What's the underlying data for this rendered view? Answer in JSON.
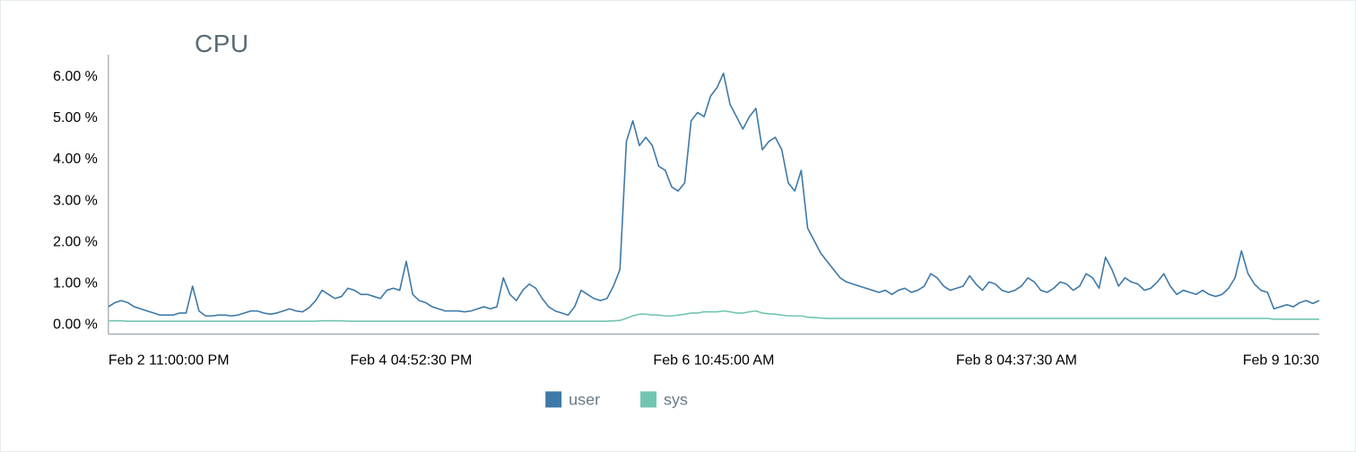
{
  "colors": {
    "user": "#3e79a8",
    "sys": "#73c5b3",
    "axis": "#9aa4ad",
    "border": "#e6ebef",
    "text": "#6a7a85"
  },
  "chart_data": {
    "type": "line",
    "title": "CPU",
    "ylabel": "",
    "xlabel": "",
    "ylim": [
      0,
      6.5
    ],
    "y_ticks": [
      "0.00 %",
      "1.00 %",
      "2.00 %",
      "3.00 %",
      "4.00 %",
      "5.00 %",
      "6.00 %"
    ],
    "x_tick_labels": [
      "Feb 2 11:00:00 PM",
      "Feb 4 04:52:30 PM",
      "Feb 6 10:45:00 AM",
      "Feb 8 04:37:30 AM",
      "Feb 9 10:30"
    ],
    "x_tick_frac": [
      0.0,
      0.25,
      0.5,
      0.75,
      1.0
    ],
    "legend": [
      "user",
      "sys"
    ],
    "series": [
      {
        "name": "user",
        "values": [
          0.4,
          0.5,
          0.55,
          0.5,
          0.4,
          0.35,
          0.3,
          0.25,
          0.2,
          0.2,
          0.2,
          0.25,
          0.25,
          0.9,
          0.3,
          0.18,
          0.18,
          0.2,
          0.2,
          0.18,
          0.2,
          0.25,
          0.3,
          0.3,
          0.25,
          0.22,
          0.25,
          0.3,
          0.35,
          0.3,
          0.28,
          0.38,
          0.55,
          0.8,
          0.7,
          0.6,
          0.65,
          0.85,
          0.8,
          0.7,
          0.7,
          0.65,
          0.6,
          0.8,
          0.85,
          0.8,
          1.5,
          0.7,
          0.55,
          0.5,
          0.4,
          0.35,
          0.3,
          0.3,
          0.3,
          0.28,
          0.3,
          0.35,
          0.4,
          0.35,
          0.4,
          1.1,
          0.7,
          0.55,
          0.8,
          0.95,
          0.85,
          0.6,
          0.4,
          0.3,
          0.25,
          0.2,
          0.4,
          0.8,
          0.7,
          0.6,
          0.55,
          0.6,
          0.9,
          1.3,
          4.4,
          4.9,
          4.3,
          4.5,
          4.3,
          3.8,
          3.7,
          3.3,
          3.2,
          3.4,
          4.9,
          5.1,
          5.0,
          5.5,
          5.7,
          6.05,
          5.3,
          5.0,
          4.7,
          5.0,
          5.2,
          4.2,
          4.4,
          4.5,
          4.2,
          3.4,
          3.2,
          3.7,
          2.3,
          2.0,
          1.7,
          1.5,
          1.3,
          1.1,
          1.0,
          0.95,
          0.9,
          0.85,
          0.8,
          0.75,
          0.8,
          0.7,
          0.8,
          0.85,
          0.75,
          0.8,
          0.9,
          1.2,
          1.1,
          0.9,
          0.8,
          0.85,
          0.9,
          1.15,
          0.95,
          0.8,
          1.0,
          0.95,
          0.8,
          0.75,
          0.8,
          0.9,
          1.1,
          1.0,
          0.8,
          0.75,
          0.85,
          1.0,
          0.95,
          0.8,
          0.9,
          1.2,
          1.1,
          0.85,
          1.6,
          1.3,
          0.9,
          1.1,
          1.0,
          0.95,
          0.8,
          0.85,
          1.0,
          1.2,
          0.9,
          0.7,
          0.8,
          0.75,
          0.7,
          0.8,
          0.7,
          0.65,
          0.7,
          0.85,
          1.1,
          1.75,
          1.2,
          0.95,
          0.8,
          0.75,
          0.35,
          0.4,
          0.45,
          0.4,
          0.5,
          0.55,
          0.48,
          0.55
        ]
      },
      {
        "name": "sys",
        "values": [
          0.06,
          0.06,
          0.06,
          0.05,
          0.05,
          0.05,
          0.05,
          0.05,
          0.05,
          0.05,
          0.05,
          0.05,
          0.05,
          0.05,
          0.05,
          0.05,
          0.05,
          0.05,
          0.05,
          0.05,
          0.05,
          0.05,
          0.05,
          0.05,
          0.05,
          0.05,
          0.05,
          0.05,
          0.05,
          0.05,
          0.05,
          0.05,
          0.05,
          0.06,
          0.06,
          0.06,
          0.06,
          0.05,
          0.05,
          0.05,
          0.05,
          0.05,
          0.05,
          0.05,
          0.05,
          0.05,
          0.05,
          0.05,
          0.05,
          0.05,
          0.05,
          0.05,
          0.05,
          0.05,
          0.05,
          0.05,
          0.05,
          0.05,
          0.05,
          0.05,
          0.05,
          0.05,
          0.05,
          0.05,
          0.05,
          0.05,
          0.05,
          0.05,
          0.05,
          0.05,
          0.05,
          0.05,
          0.05,
          0.05,
          0.05,
          0.05,
          0.05,
          0.05,
          0.06,
          0.07,
          0.12,
          0.18,
          0.22,
          0.22,
          0.2,
          0.2,
          0.18,
          0.18,
          0.2,
          0.22,
          0.25,
          0.25,
          0.28,
          0.28,
          0.28,
          0.3,
          0.28,
          0.25,
          0.25,
          0.28,
          0.3,
          0.25,
          0.23,
          0.22,
          0.2,
          0.18,
          0.18,
          0.18,
          0.15,
          0.14,
          0.13,
          0.12,
          0.12,
          0.12,
          0.12,
          0.12,
          0.12,
          0.12,
          0.12,
          0.12,
          0.12,
          0.12,
          0.12,
          0.12,
          0.12,
          0.12,
          0.12,
          0.12,
          0.12,
          0.12,
          0.12,
          0.12,
          0.12,
          0.12,
          0.12,
          0.12,
          0.12,
          0.12,
          0.12,
          0.12,
          0.12,
          0.12,
          0.12,
          0.12,
          0.12,
          0.12,
          0.12,
          0.12,
          0.12,
          0.12,
          0.12,
          0.12,
          0.12,
          0.12,
          0.12,
          0.12,
          0.12,
          0.12,
          0.12,
          0.12,
          0.12,
          0.12,
          0.12,
          0.12,
          0.12,
          0.12,
          0.12,
          0.12,
          0.12,
          0.12,
          0.12,
          0.12,
          0.12,
          0.12,
          0.12,
          0.12,
          0.12,
          0.12,
          0.12,
          0.12,
          0.1,
          0.1,
          0.1,
          0.1,
          0.1,
          0.1,
          0.1,
          0.1
        ]
      }
    ]
  }
}
